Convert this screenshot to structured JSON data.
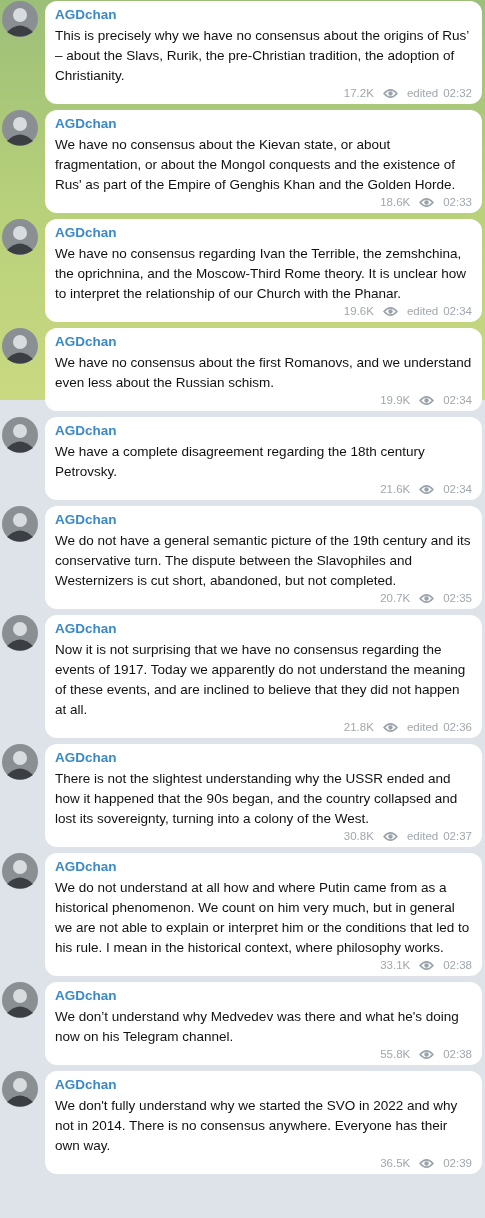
{
  "messages": [
    {
      "author": "AGDchan",
      "text": "This is precisely why we have no consensus about the origins of Rus’ – about the Slavs, Rurik, the pre-Christian tradition, the adoption of Christianity.",
      "views": "17.2K",
      "edited": "edited",
      "time": "02:32"
    },
    {
      "author": "AGDchan",
      "text": "We have no consensus about the Kievan state, or about fragmentation, or about the Mongol conquests and the existence of Rus' as part of the Empire of Genghis Khan and the Golden Horde.",
      "views": "18.6K",
      "time": "02:33"
    },
    {
      "author": "AGDchan",
      "text": "We have no consensus regarding Ivan the Terrible, the zemshchina, the oprichnina, and the Moscow-Third Rome theory. It is unclear how to interpret the relationship of our Church with the Phanar.",
      "views": "19.6K",
      "edited": "edited",
      "time": "02:34"
    },
    {
      "author": "AGDchan",
      "text": "We have no consensus about the first Romanovs, and we understand even less about the Russian schism.",
      "views": "19.9K",
      "time": "02:34"
    },
    {
      "author": "AGDchan",
      "text": "We have a complete disagreement regarding the 18th century Petrovsky.",
      "views": "21.6K",
      "time": "02:34"
    },
    {
      "author": "AGDchan",
      "text": "We do not have a general semantic picture of the 19th century and its conservative turn. The dispute between the Slavophiles and Westernizers is cut short, abandoned, but not completed.",
      "views": "20.7K",
      "time": "02:35"
    },
    {
      "author": "AGDchan",
      "text": "Now it is not surprising that we have no consensus regarding the events of 1917. Today we apparently do not understand the meaning of these events, and are inclined to believe that they did not happen at all.",
      "views": "21.8K",
      "edited": "edited",
      "time": "02:36"
    },
    {
      "author": "AGDchan",
      "text": "There is not the slightest understanding why the USSR ended and how it happened that the 90s began, and the country collapsed and lost its sovereignty, turning into a colony of the West.",
      "views": "30.8K",
      "edited": "edited",
      "time": "02:37"
    },
    {
      "author": "AGDchan",
      "text": "We do not understand at all how and where Putin came from as a historical phenomenon. We count on him very much, but in general we are not able to explain or interpret him or the conditions that led to his rule. I mean in the historical context, where philosophy works.",
      "views": "33.1K",
      "time": "02:38"
    },
    {
      "author": "AGDchan",
      "text": "We don’t understand why Medvedev was there and what he's doing now on his Telegram channel.",
      "views": "55.8K",
      "time": "02:38"
    },
    {
      "author": "AGDchan",
      "text": "We don't fully understand why we started the SVO in 2022 and why not in 2014. There is no consensus anywhere. Everyone has their own way.",
      "views": "36.5K",
      "time": "02:39"
    }
  ]
}
